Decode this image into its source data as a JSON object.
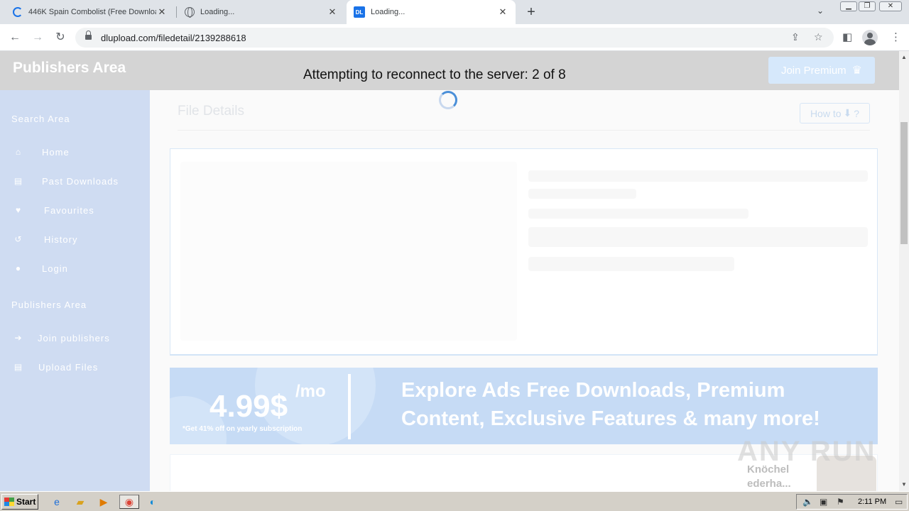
{
  "browser": {
    "tabs": [
      {
        "title": "446K Spain Combolist (Free Downloa",
        "favicon": "loading-spinner-icon",
        "active": false
      },
      {
        "title": "Loading...",
        "favicon": "globe-icon",
        "active": false
      },
      {
        "title": "Loading...",
        "favicon": "dl-logo-icon",
        "favicon_text": "DL",
        "active": true
      }
    ],
    "new_tab_symbol": "+",
    "tab_list_symbol": "⌄",
    "window_controls": [
      "minimize",
      "restore",
      "close"
    ],
    "url": "dlupload.com/filedetail/2139288618"
  },
  "page": {
    "brand": "Publishers Area",
    "reconnect_message": "Attempting to reconnect to the server: 2 of 8",
    "join_premium_label": "Join Premium",
    "file_details_title": "File Details",
    "howto_label": "How to",
    "howto_suffix": "?",
    "sidebar": {
      "search_heading": "Search Area",
      "nav": [
        {
          "label": "Home",
          "icon": "home-icon",
          "glyph": "⌂"
        },
        {
          "label": "Past Downloads",
          "icon": "file-download-icon",
          "glyph": "▤"
        },
        {
          "label": "Favourites",
          "icon": "heart-icon",
          "glyph": "♥"
        },
        {
          "label": "History",
          "icon": "history-icon",
          "glyph": "↺"
        },
        {
          "label": "Login",
          "icon": "user-icon",
          "glyph": "●"
        }
      ],
      "publishers_heading": "Publishers Area",
      "publisher_nav": [
        {
          "label": "Join publishers",
          "icon": "sign-in-icon",
          "glyph": "➔"
        },
        {
          "label": "Upload Files",
          "icon": "file-upload-icon",
          "glyph": "▤"
        }
      ]
    },
    "promo": {
      "price": "4.99$",
      "per": "/mo",
      "note": "*Get 41% off on yearly subscription",
      "line1": "Explore Ads Free Downloads, Premium",
      "line2": "Content, Exclusive Features & many more!"
    },
    "watermark": {
      "text": "ANY RUN",
      "sub_line1": "Knöchel",
      "sub_line2": "ederha..."
    }
  },
  "taskbar": {
    "start_label": "Start",
    "apps": [
      "internet-explorer-icon",
      "file-explorer-icon",
      "media-player-icon",
      "chrome-icon",
      "edge-icon"
    ],
    "clock": "2:11 PM"
  }
}
